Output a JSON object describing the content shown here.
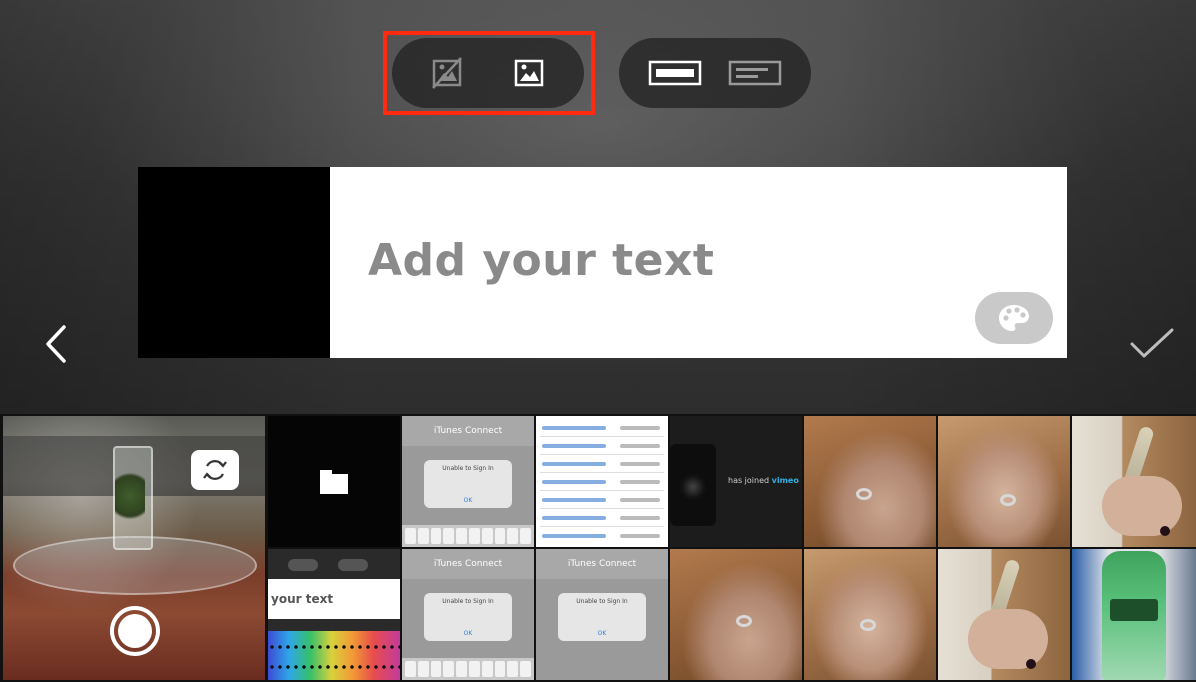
{
  "editor": {
    "placeholder_text": "Add your text",
    "highlight_color": "#ff2a10"
  },
  "toolbar": {
    "image_toggle": [
      {
        "icon": "no-image-icon"
      },
      {
        "icon": "image-icon"
      }
    ],
    "layout_toggle": [
      {
        "icon": "layout-banner-icon"
      },
      {
        "icon": "layout-text-block-icon"
      }
    ]
  },
  "navigation": {
    "back_icon": "chevron-left-icon",
    "done_icon": "checkmark-icon"
  },
  "gallery": {
    "camera": {
      "switch_icon": "switch-camera-icon",
      "shutter_icon": "shutter-icon"
    },
    "thumbs": [
      {
        "title": "iTunes Connect",
        "dialog_title": "Unable to Sign In",
        "ok": "OK"
      },
      {
        "title": "iTunes Connect",
        "dialog_title": "Unable to Sign In",
        "ok": "OK"
      },
      {
        "title": "iTunes Connect",
        "dialog_title": "Unable to Sign In",
        "ok": "OK"
      }
    ],
    "vimeo_caption_prefix": "has joined",
    "vimeo_brand": "vimeo",
    "editor_thumb_text": "your text"
  }
}
